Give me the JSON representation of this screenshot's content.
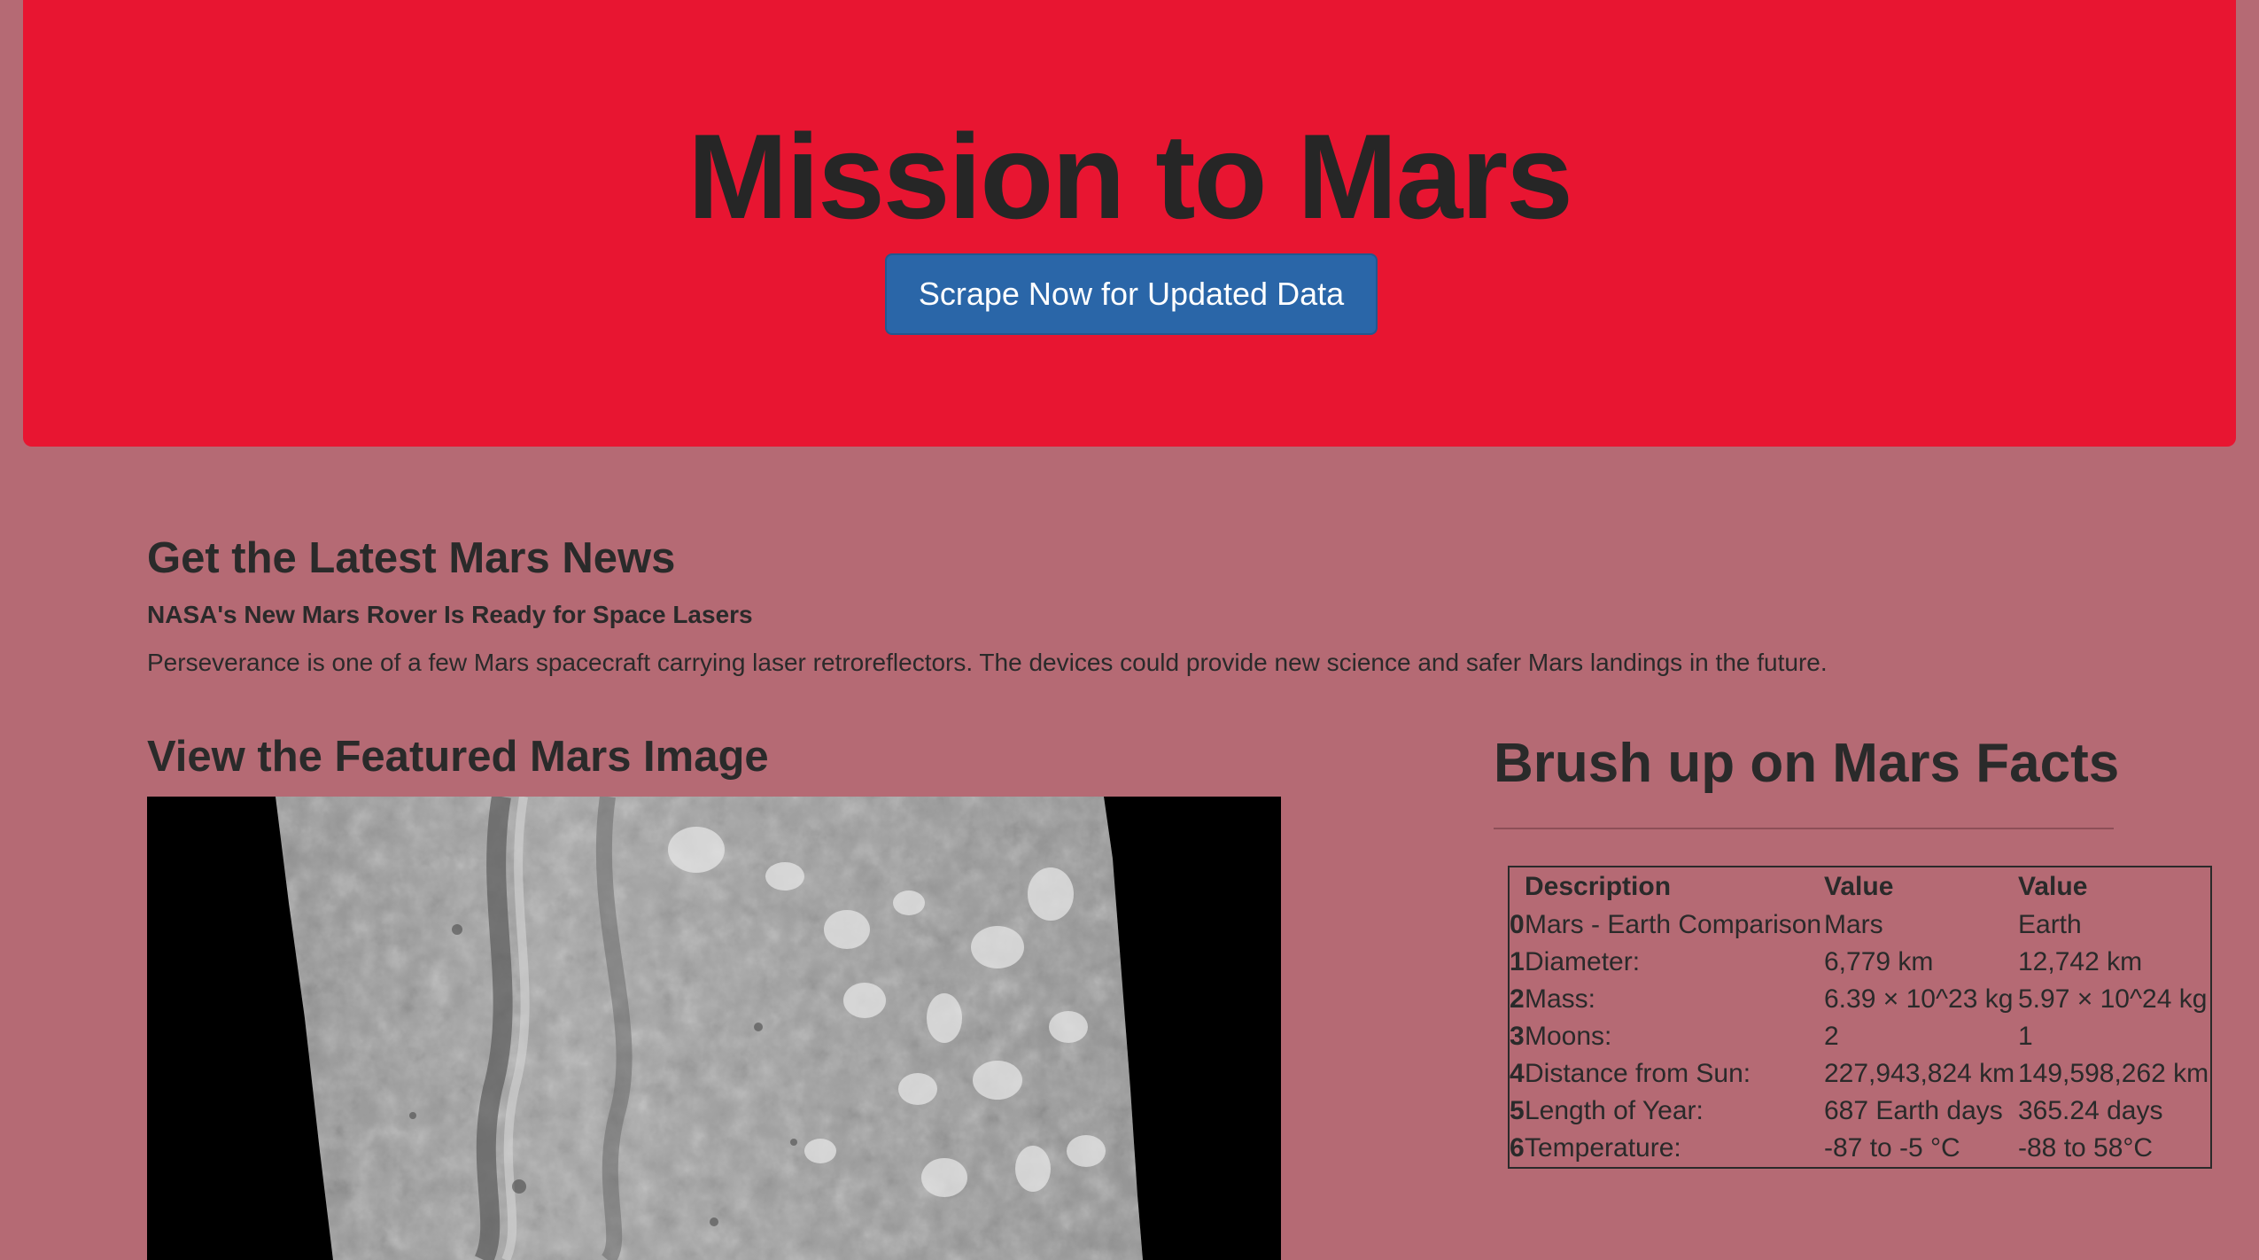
{
  "jumbotron": {
    "title": "Mission to Mars",
    "button_label": "Scrape Now for Updated Data"
  },
  "news": {
    "heading": "Get the Latest Mars News",
    "title": "NASA's New Mars Rover Is Ready for Space Lasers",
    "teaser": "Perseverance is one of a few Mars spacecraft carrying laser retroreflectors. The devices could provide new science and safer Mars landings in the future."
  },
  "featured_image": {
    "heading": "View the Featured Mars Image"
  },
  "facts": {
    "heading": "Brush up on Mars Facts",
    "columns": [
      "Description",
      "Value",
      "Value"
    ],
    "rows": [
      {
        "index": "0",
        "description": "Mars - Earth Comparison",
        "mars": "Mars",
        "earth": "Earth"
      },
      {
        "index": "1",
        "description": "Diameter:",
        "mars": "6,779 km",
        "earth": "12,742 km"
      },
      {
        "index": "2",
        "description": "Mass:",
        "mars": "6.39 × 10^23 kg",
        "earth": "5.97 × 10^24 kg"
      },
      {
        "index": "3",
        "description": "Moons:",
        "mars": "2",
        "earth": "1"
      },
      {
        "index": "4",
        "description": "Distance from Sun:",
        "mars": "227,943,824 km",
        "earth": "149,598,262 km"
      },
      {
        "index": "5",
        "description": "Length of Year:",
        "mars": "687 Earth days",
        "earth": "365.24 days"
      },
      {
        "index": "6",
        "description": "Temperature:",
        "mars": "-87 to -5 °C",
        "earth": "-88 to 58°C"
      }
    ]
  },
  "colors": {
    "page_background": "#b56a74",
    "jumbotron_background": "#e81531",
    "button_background": "#2a66a8",
    "text": "#2a2a2a"
  }
}
